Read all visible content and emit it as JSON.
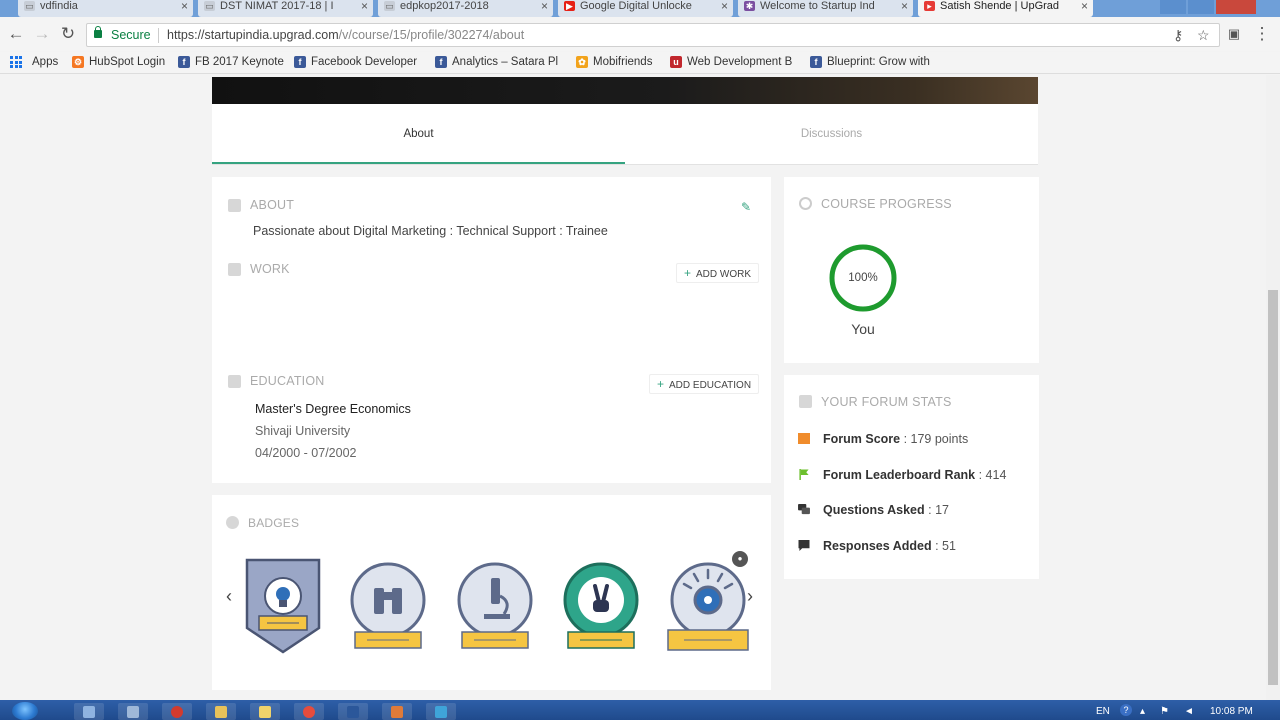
{
  "browser": {
    "tabs": [
      {
        "title": "vdfindia",
        "favicon": "page-icon",
        "active": false
      },
      {
        "title": "DST NIMAT 2017-18 | I",
        "favicon": "page-icon",
        "active": false
      },
      {
        "title": "edpkop2017-2018",
        "favicon": "page-icon",
        "active": false
      },
      {
        "title": "Google Digital Unlocke",
        "favicon": "youtube-icon",
        "active": false
      },
      {
        "title": "Welcome to Startup Ind",
        "favicon": "startup-india-icon",
        "active": false
      },
      {
        "title": "Satish Shende | UpGrad",
        "favicon": "upgrad-icon",
        "active": true
      }
    ],
    "secure_label": "Secure",
    "url_main": "https://startupindia.upgrad.com",
    "url_path": "/v/course/15/profile/302274/about",
    "bookmarks": [
      {
        "label": "Apps",
        "icon": "apps-grid-icon"
      },
      {
        "label": "HubSpot Login",
        "icon": "hubspot-icon"
      },
      {
        "label": "FB 2017 Keynote",
        "icon": "facebook-icon"
      },
      {
        "label": "Facebook Developer",
        "icon": "facebook-icon"
      },
      {
        "label": "Analytics – Satara Pl",
        "icon": "facebook-icon"
      },
      {
        "label": "Mobifriends",
        "icon": "mobifriends-icon"
      },
      {
        "label": "Web Development B",
        "icon": "web-dev-icon"
      },
      {
        "label": "Blueprint: Grow with",
        "icon": "facebook-icon"
      }
    ]
  },
  "profile_tabs": {
    "about": "About",
    "discussions": "Discussions"
  },
  "about": {
    "title": "ABOUT",
    "text": "Passionate about Digital Marketing : Technical Support : Trainee"
  },
  "work": {
    "title": "WORK",
    "add_label": "ADD WORK"
  },
  "education": {
    "title": "EDUCATION",
    "add_label": "ADD EDUCATION",
    "degree": "Master's Degree Economics",
    "school": "Shivaji University",
    "dates": "04/2000 - 07/2002"
  },
  "badges": {
    "title": "BADGES",
    "items": [
      {
        "name": "badge-bright-ideas",
        "color": "#f5c542",
        "ring": "#5d6a8a"
      },
      {
        "name": "badge-curious",
        "color": "#f5c542",
        "ring": "#5d6a8a"
      },
      {
        "name": "badge-inquisitive",
        "color": "#f5c542",
        "ring": "#5d6a8a"
      },
      {
        "name": "badge-web-warrior",
        "color": "#f5c542",
        "ring": "#2ea58a"
      },
      {
        "name": "badge-original",
        "color": "#f5c542",
        "ring": "#5d6a8a"
      }
    ]
  },
  "course_progress": {
    "title": "COURSE PROGRESS",
    "percent_label": "100%",
    "percent": 100,
    "user_label": "You",
    "ring_color": "#1e9b2e"
  },
  "forum_stats": {
    "title": "YOUR FORUM STATS",
    "rows": [
      {
        "label": "Forum Score",
        "value": " : 179 points",
        "icon": "score-icon",
        "color": "#f08c2c"
      },
      {
        "label": "Forum Leaderboard Rank",
        "value": " : 414",
        "icon": "flag-icon",
        "color": "#6cbf2d"
      },
      {
        "label": "Questions Asked",
        "value": " : 17",
        "icon": "question-icon",
        "color": "#333333"
      },
      {
        "label": "Responses Added",
        "value": " : 51",
        "icon": "response-icon",
        "color": "#333333"
      }
    ]
  },
  "taskbar": {
    "language": "EN",
    "time": "10:08 PM"
  }
}
